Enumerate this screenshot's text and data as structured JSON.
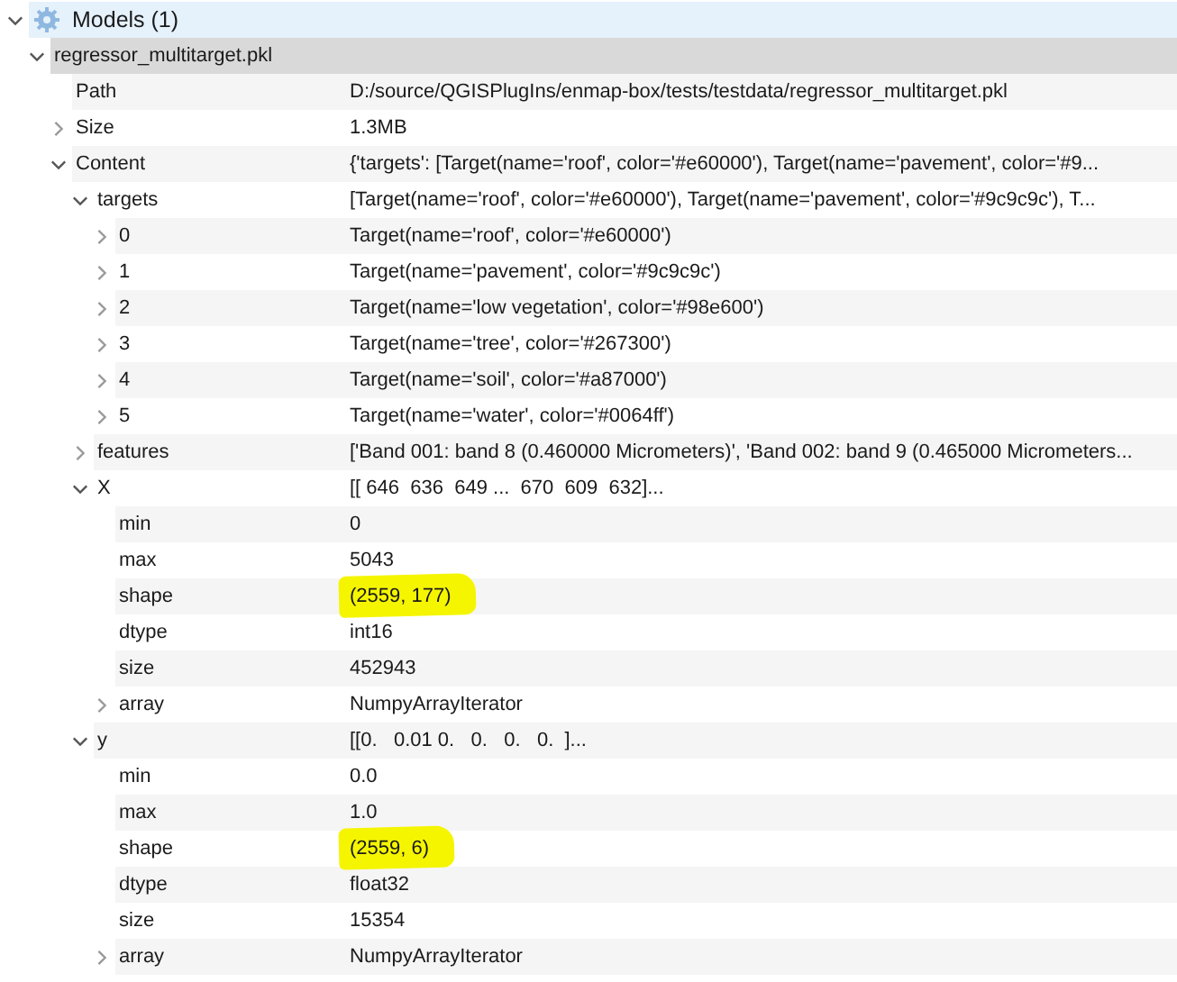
{
  "group": {
    "label": "Models (1)",
    "expanded": true,
    "children": [
      {
        "label": "regressor_multitarget.pkl",
        "expanded": true,
        "selected": true,
        "highlighted": false,
        "children": [
          {
            "label": "Path",
            "value": "D:/source/QGISPlugIns/enmap-box/tests/testdata/regressor_multitarget.pkl",
            "selected": false,
            "highlighted": false
          },
          {
            "label": "Size",
            "value": "1.3MB",
            "expanded": false,
            "selected": false,
            "highlighted": false
          },
          {
            "label": "Content",
            "value": "{'targets': [Target(name='roof', color='#e60000'), Target(name='pavement', color='#9...",
            "expanded": true,
            "selected": false,
            "highlighted": false,
            "children": [
              {
                "label": "targets",
                "value": "[Target(name='roof', color='#e60000'), Target(name='pavement', color='#9c9c9c'), T...",
                "expanded": true,
                "selected": false,
                "highlighted": false,
                "children": [
                  {
                    "label": "0",
                    "value": "Target(name='roof', color='#e60000')",
                    "expanded": false,
                    "selected": false,
                    "highlighted": false
                  },
                  {
                    "label": "1",
                    "value": "Target(name='pavement', color='#9c9c9c')",
                    "expanded": false,
                    "selected": false,
                    "highlighted": false
                  },
                  {
                    "label": "2",
                    "value": "Target(name='low vegetation', color='#98e600')",
                    "expanded": false,
                    "selected": false,
                    "highlighted": false
                  },
                  {
                    "label": "3",
                    "value": "Target(name='tree', color='#267300')",
                    "expanded": false,
                    "selected": false,
                    "highlighted": false
                  },
                  {
                    "label": "4",
                    "value": "Target(name='soil', color='#a87000')",
                    "expanded": false,
                    "selected": false,
                    "highlighted": false
                  },
                  {
                    "label": "5",
                    "value": "Target(name='water', color='#0064ff')",
                    "expanded": false,
                    "selected": false,
                    "highlighted": false
                  }
                ]
              },
              {
                "label": "features",
                "value": "['Band 001: band 8 (0.460000 Micrometers)', 'Band 002: band 9 (0.465000 Micrometers...",
                "expanded": false,
                "selected": false,
                "highlighted": false
              },
              {
                "label": "X",
                "value": "[[ 646  636  649 ...  670  609  632]...",
                "expanded": true,
                "selected": false,
                "highlighted": false,
                "children": [
                  {
                    "label": "min",
                    "value": "0",
                    "selected": false,
                    "highlighted": false
                  },
                  {
                    "label": "max",
                    "value": "5043",
                    "selected": false,
                    "highlighted": false
                  },
                  {
                    "label": "shape",
                    "value": "(2559, 177)",
                    "selected": false,
                    "highlighted": true
                  },
                  {
                    "label": "dtype",
                    "value": "int16",
                    "selected": false,
                    "highlighted": false
                  },
                  {
                    "label": "size",
                    "value": "452943",
                    "selected": false,
                    "highlighted": false
                  },
                  {
                    "label": "array",
                    "value": "NumpyArrayIterator",
                    "expanded": false,
                    "selected": false,
                    "highlighted": false
                  }
                ]
              },
              {
                "label": "y",
                "value": "[[0.   0.01 0.   0.   0.   0.  ]...",
                "expanded": true,
                "selected": false,
                "highlighted": false,
                "children": [
                  {
                    "label": "min",
                    "value": "0.0",
                    "selected": false,
                    "highlighted": false
                  },
                  {
                    "label": "max",
                    "value": "1.0",
                    "selected": false,
                    "highlighted": false
                  },
                  {
                    "label": "shape",
                    "value": "(2559, 6)",
                    "selected": false,
                    "highlighted": true
                  },
                  {
                    "label": "dtype",
                    "value": "float32",
                    "selected": false,
                    "highlighted": false
                  },
                  {
                    "label": "size",
                    "value": "15354",
                    "selected": false,
                    "highlighted": false
                  },
                  {
                    "label": "array",
                    "value": "NumpyArrayIterator",
                    "expanded": false,
                    "selected": false,
                    "highlighted": false
                  }
                ]
              }
            ]
          }
        ]
      }
    ]
  }
}
